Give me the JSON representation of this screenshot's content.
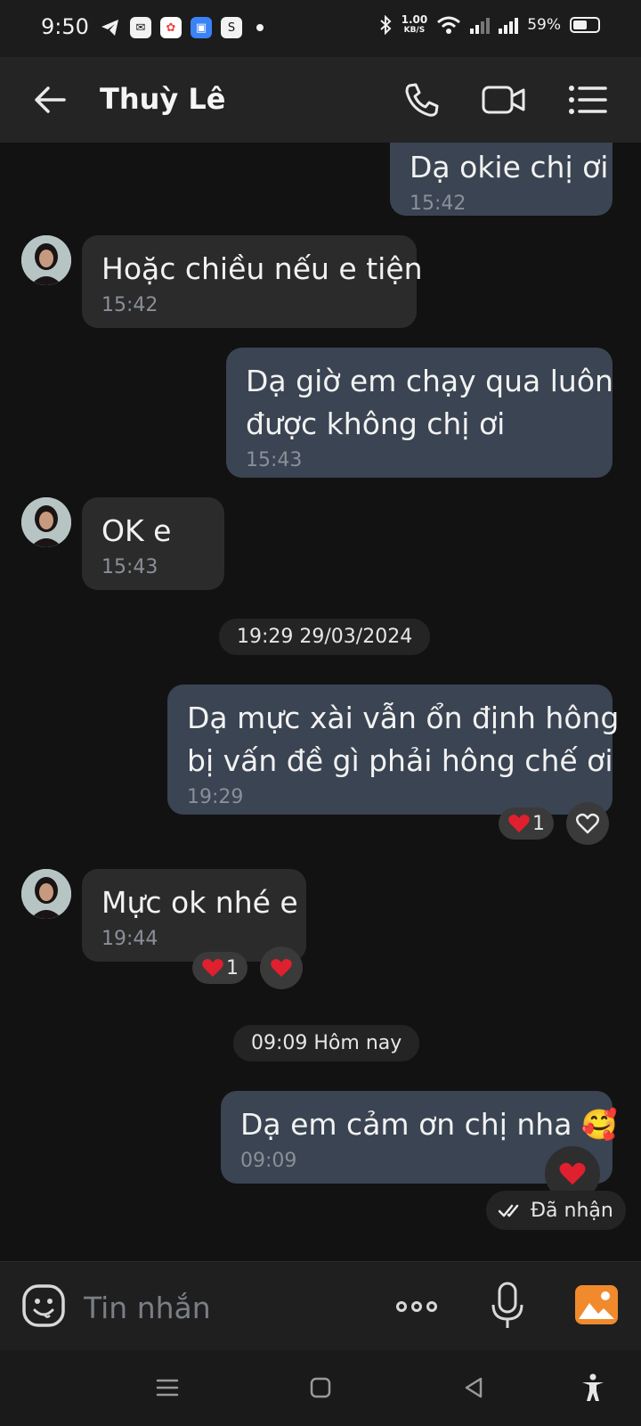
{
  "status_bar": {
    "time": "9:50",
    "speed_value": "1.00",
    "speed_unit": "KB/S",
    "battery": "59%",
    "battery_level": 0.59,
    "app_icons": [
      "telegram-icon",
      "messenger-icon",
      "photos-icon",
      "files-icon",
      "shopee-icon"
    ]
  },
  "header": {
    "contact_name": "Thuỳ Lê",
    "actions": [
      "phone-icon",
      "video-call-icon",
      "menu-icon"
    ]
  },
  "messages": [
    {
      "direction": "out",
      "lines": [
        "Dạ okie chị ơi"
      ],
      "time": "15:42"
    },
    {
      "direction": "in",
      "lines": [
        "Hoặc chiều nếu e tiện"
      ],
      "time": "15:42"
    },
    {
      "direction": "out",
      "lines": [
        "Dạ giờ em chạy qua luôn",
        "được không chị ơi"
      ],
      "time": "15:43"
    },
    {
      "direction": "in",
      "lines": [
        "OK e"
      ],
      "time": "15:43"
    },
    {
      "direction": "out",
      "lines": [
        "Dạ mực xài vẫn ổn định hông",
        "bị vấn đề gì phải hông chế ơi"
      ],
      "time": "19:29",
      "reaction_count": "1"
    },
    {
      "direction": "in",
      "lines": [
        "Mực ok nhé e"
      ],
      "time": "19:44",
      "reaction_count": "1"
    },
    {
      "direction": "out",
      "lines": [
        "Dạ em cảm ơn chị nha 🥰"
      ],
      "time": "09:09"
    }
  ],
  "date_separators": [
    "19:29 29/03/2024",
    "09:09 Hôm nay"
  ],
  "delivery_status": "Đã nhận",
  "composer": {
    "placeholder": "Tin nhắn"
  },
  "colors": {
    "incoming_bubble": "#2b2b2b",
    "outgoing_bubble": "#3a4452",
    "heart": "#e0202e",
    "photo_button": "#f08a2c"
  }
}
